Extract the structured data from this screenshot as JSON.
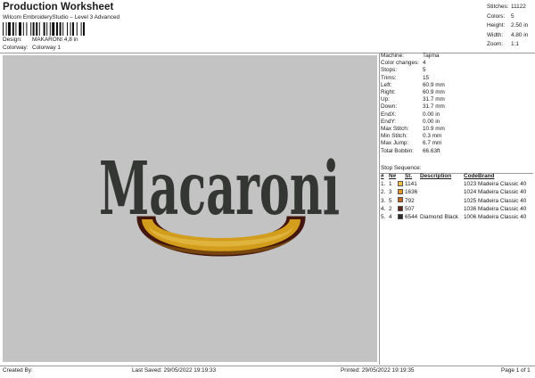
{
  "header": {
    "title": "Production Worksheet",
    "subtitle": "Wilcom EmbroideryStudio – Level 3 Advanced",
    "design_label": "Design:",
    "design_value": "MAKARONI 4,8 in",
    "colorway_label": "Colorway:",
    "colorway_value": "Colorway 1"
  },
  "summary": [
    {
      "k": "Stitches:",
      "v": "11122"
    },
    {
      "k": "Colors:",
      "v": "5"
    },
    {
      "k": "Height:",
      "v": "2.50 in"
    },
    {
      "k": "Width:",
      "v": "4.80 in"
    },
    {
      "k": "Zoom:",
      "v": "1:1"
    }
  ],
  "machine_info": [
    {
      "k": "Machine:",
      "v": "Tajima"
    },
    {
      "k": "Color changes:",
      "v": "4"
    },
    {
      "k": "Stops:",
      "v": "5"
    },
    {
      "k": "Trims:",
      "v": "15"
    },
    {
      "k": "Left:",
      "v": "60.9 mm"
    },
    {
      "k": "Right:",
      "v": "60.9 mm"
    },
    {
      "k": "Up:",
      "v": "31.7 mm"
    },
    {
      "k": "Down:",
      "v": "31.7 mm"
    },
    {
      "k": "EndX:",
      "v": "0.00 in"
    },
    {
      "k": "EndY:",
      "v": "0.00 in"
    },
    {
      "k": "Max Stitch:",
      "v": "10.9 mm"
    },
    {
      "k": "Min Stitch:",
      "v": "0.3 mm"
    },
    {
      "k": "Max Jump:",
      "v": "6.7 mm"
    },
    {
      "k": "Total Bobbin:",
      "v": "66.63ft"
    }
  ],
  "stop_sequence": {
    "heading": "Stop Sequence:",
    "columns": {
      "num": "#",
      "n": "N#",
      "st": "St.",
      "desc": "Description",
      "code": "Code",
      "brand": "Brand"
    },
    "rows": [
      {
        "num": "1.",
        "n": "1",
        "st": "1141",
        "desc": "",
        "code": "1023",
        "brand": "Madeira Classic 40",
        "color": "#f6c341"
      },
      {
        "num": "2.",
        "n": "3",
        "st": "1636",
        "desc": "",
        "code": "1024",
        "brand": "Madeira Classic 40",
        "color": "#e8962a"
      },
      {
        "num": "3.",
        "n": "5",
        "st": "792",
        "desc": "",
        "code": "1025",
        "brand": "Madeira Classic 40",
        "color": "#c8651d"
      },
      {
        "num": "4.",
        "n": "2",
        "st": "507",
        "desc": "",
        "code": "1036",
        "brand": "Madeira Classic 40",
        "color": "#5c2416"
      },
      {
        "num": "5.",
        "n": "4",
        "st": "6544",
        "desc": "Diamond Black",
        "code": "1006",
        "brand": "Madeira Classic 40",
        "color": "#2a2a2a"
      }
    ]
  },
  "artwork": {
    "word": "Macaroni",
    "text_color": "#3a3d3a",
    "pasta_fill": "#e5ac21",
    "pasta_highlight": "#f6c84a",
    "pasta_shadow": "#b0741a",
    "pasta_outline": "#4c1f15",
    "canvas_color": "#c3c3c3"
  },
  "footer": {
    "created_by": "Created By:",
    "last_saved": "Last Saved: 29/05/2022 19:19:33",
    "printed": "Printed: 29/05/2022 19:19:35",
    "page": "Page 1 of 1"
  }
}
